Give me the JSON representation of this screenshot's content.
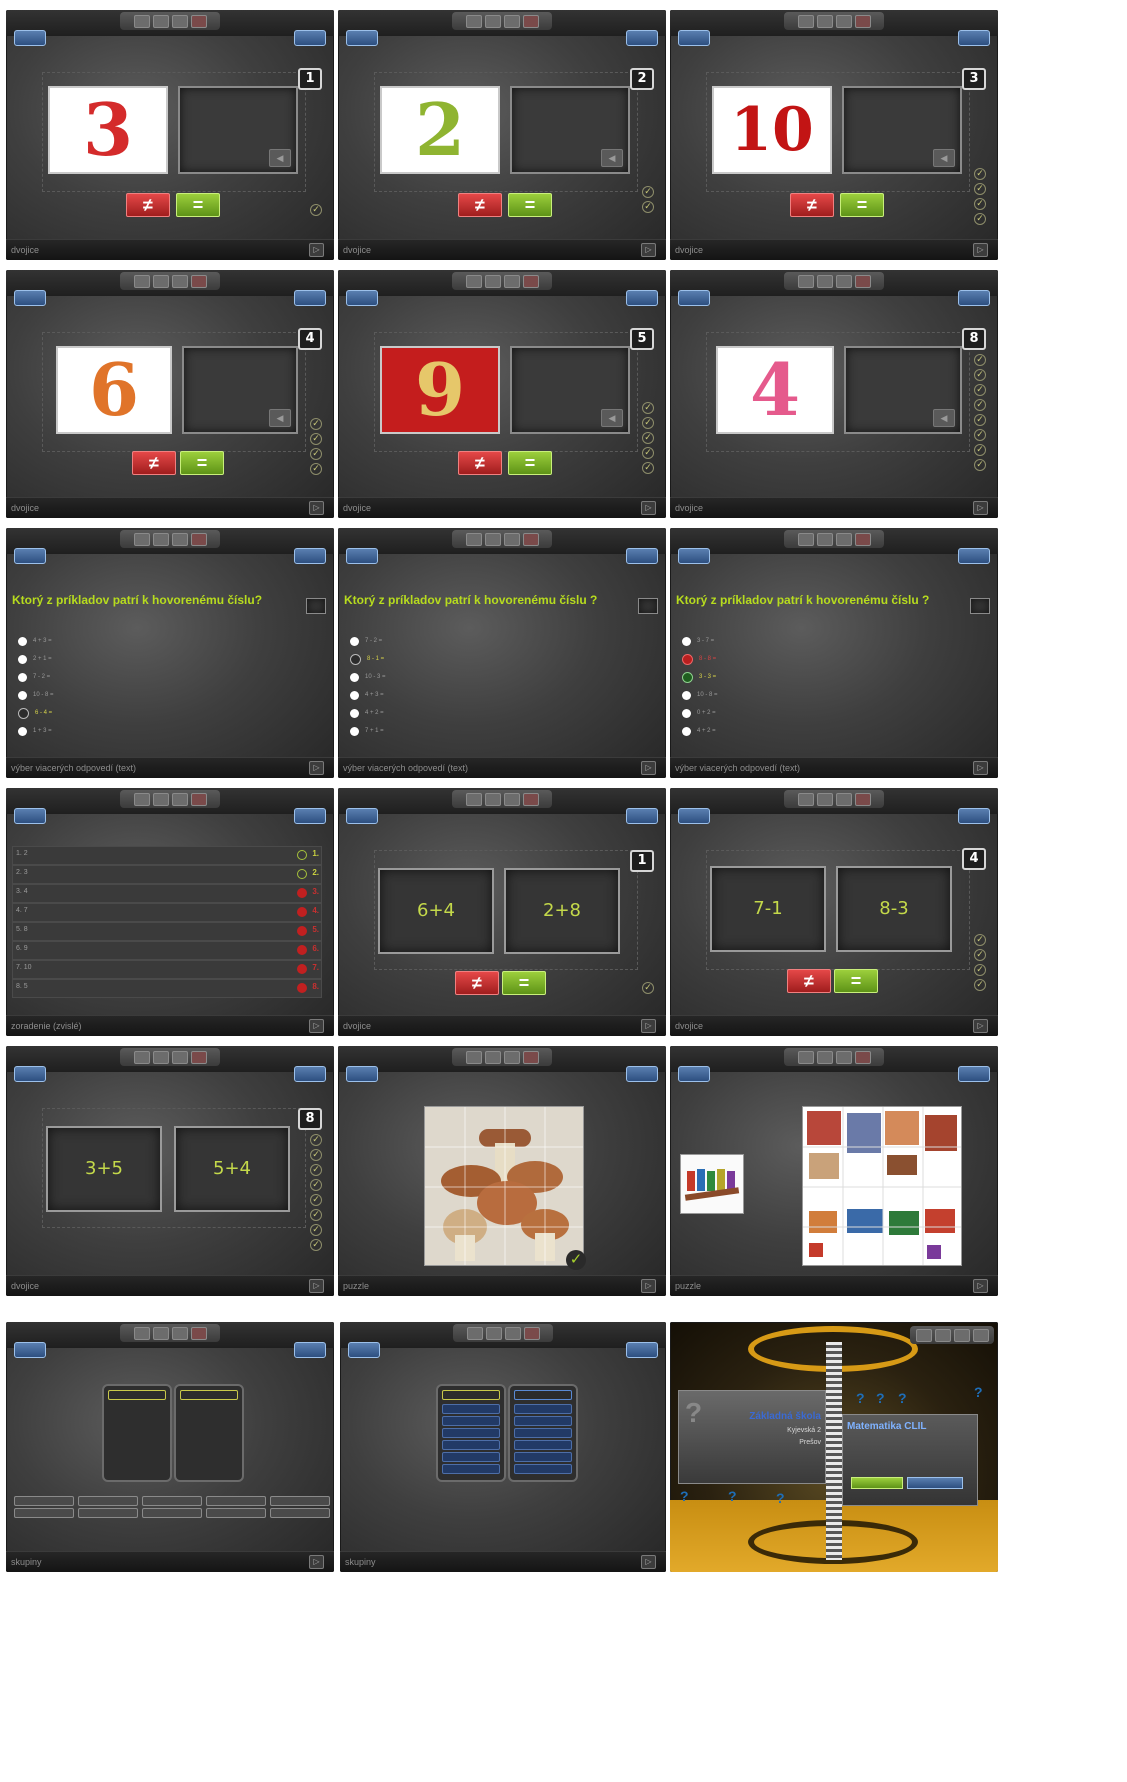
{
  "panel_labels": {
    "pairs": "dvojice",
    "multi_text": "výber viacerých odpovedí (text)",
    "order": "zoradenie (zvislé)",
    "puzzle": "puzzle",
    "groups": "skupiny"
  },
  "buttons": {
    "not_equal": "≠",
    "equal": "="
  },
  "numbers_tasks": [
    {
      "image_digit": "3",
      "counter": "1",
      "checks": 1
    },
    {
      "image_digit": "2",
      "counter": "2",
      "checks": 2
    },
    {
      "image_digit": "10",
      "counter": "3",
      "checks": 4
    },
    {
      "image_digit": "6",
      "counter": "4",
      "checks": 4
    },
    {
      "image_digit": "9",
      "counter": "5",
      "checks": 5
    },
    {
      "image_digit": "4",
      "counter": "8",
      "checks": 8
    }
  ],
  "questions": [
    {
      "text": "Ktorý z príkladov  patrí k hovorenému číslu?"
    },
    {
      "text": "Ktorý z príkladov patrí k hovorenému číslu ?"
    },
    {
      "text": "Ktorý z príkladov patrí k hovorenému číslu ?"
    }
  ],
  "order_rows": [
    {
      "label": "1.  2",
      "ok": true,
      "rank": "1."
    },
    {
      "label": "2.  3",
      "ok": true,
      "rank": "2."
    },
    {
      "label": "3.  4",
      "ok": false,
      "rank": "3."
    },
    {
      "label": "4.  7",
      "ok": false,
      "rank": "4."
    },
    {
      "label": "5.  8",
      "ok": false,
      "rank": "5."
    },
    {
      "label": "6.  9",
      "ok": false,
      "rank": "6."
    },
    {
      "label": "7.  10",
      "ok": false,
      "rank": "7."
    },
    {
      "label": "8.  5",
      "ok": false,
      "rank": "8."
    }
  ],
  "math_pairs": [
    {
      "left": "6+4",
      "right": "2+8",
      "counter": "1"
    },
    {
      "left": "7-1",
      "right": "8-3",
      "counter": "4"
    },
    {
      "left": "3+5",
      "right": "5+4",
      "counter": "8"
    }
  ],
  "title_card": {
    "school": "Základná škola",
    "subject": "Matematika CLIL",
    "line1": "Kyjevská 2",
    "line2": "Prešov",
    "check": "✓"
  },
  "colors": {
    "accent_green": "#b7dc1e",
    "red": "#d42b2b",
    "gold": "#d79a16"
  }
}
